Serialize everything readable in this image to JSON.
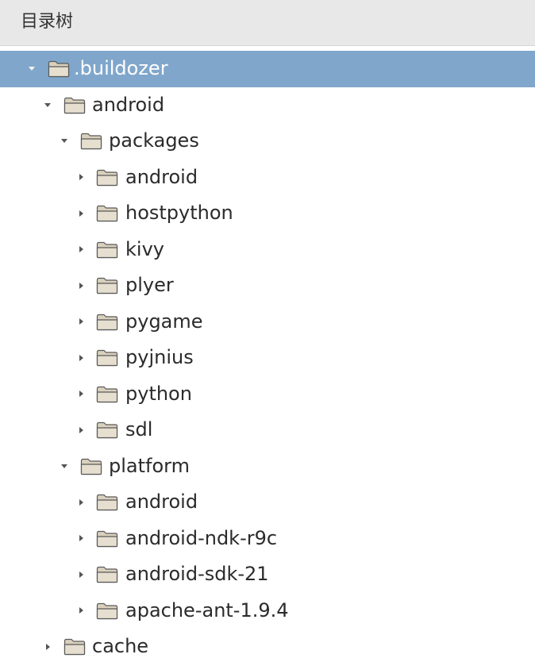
{
  "header": {
    "title": "目录树"
  },
  "colors": {
    "header_bg": "#e8e8e8",
    "selected_row_bg": "#80a6cb",
    "folder_body": "#d9d0bd",
    "folder_outline": "#5a5a5a"
  },
  "tree": {
    "rows": [
      {
        "label": ".buildozer",
        "level": 0,
        "expanded": true,
        "selected": true,
        "icon": "folder-icon"
      },
      {
        "label": "android",
        "level": 1,
        "expanded": true,
        "selected": false,
        "icon": "folder-icon"
      },
      {
        "label": "packages",
        "level": 2,
        "expanded": true,
        "selected": false,
        "icon": "folder-icon"
      },
      {
        "label": "android",
        "level": 3,
        "expanded": false,
        "selected": false,
        "icon": "folder-icon"
      },
      {
        "label": "hostpython",
        "level": 3,
        "expanded": false,
        "selected": false,
        "icon": "folder-icon"
      },
      {
        "label": "kivy",
        "level": 3,
        "expanded": false,
        "selected": false,
        "icon": "folder-icon"
      },
      {
        "label": "plyer",
        "level": 3,
        "expanded": false,
        "selected": false,
        "icon": "folder-icon"
      },
      {
        "label": "pygame",
        "level": 3,
        "expanded": false,
        "selected": false,
        "icon": "folder-icon"
      },
      {
        "label": "pyjnius",
        "level": 3,
        "expanded": false,
        "selected": false,
        "icon": "folder-icon"
      },
      {
        "label": "python",
        "level": 3,
        "expanded": false,
        "selected": false,
        "icon": "folder-icon"
      },
      {
        "label": "sdl",
        "level": 3,
        "expanded": false,
        "selected": false,
        "icon": "folder-icon"
      },
      {
        "label": "platform",
        "level": 2,
        "expanded": true,
        "selected": false,
        "icon": "folder-icon"
      },
      {
        "label": "android",
        "level": 3,
        "expanded": false,
        "selected": false,
        "icon": "folder-icon"
      },
      {
        "label": "android-ndk-r9c",
        "level": 3,
        "expanded": false,
        "selected": false,
        "icon": "folder-icon"
      },
      {
        "label": "android-sdk-21",
        "level": 3,
        "expanded": false,
        "selected": false,
        "icon": "folder-icon"
      },
      {
        "label": "apache-ant-1.9.4",
        "level": 3,
        "expanded": false,
        "selected": false,
        "icon": "folder-icon"
      },
      {
        "label": "cache",
        "level": 1,
        "expanded": false,
        "selected": false,
        "icon": "folder-icon"
      }
    ]
  }
}
